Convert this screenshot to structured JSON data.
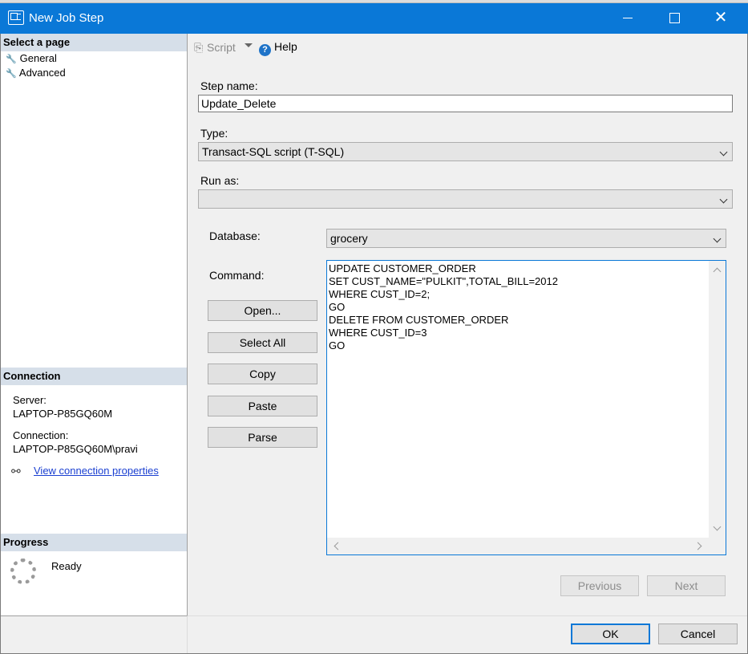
{
  "window": {
    "title": "New Job Step"
  },
  "left_panel": {
    "select_page_header": "Select a page",
    "pages": [
      {
        "label": "General"
      },
      {
        "label": "Advanced"
      }
    ],
    "connection_header": "Connection",
    "server_label": "Server:",
    "server_value": "LAPTOP-P85GQ60M",
    "connection_label": "Connection:",
    "connection_value": "LAPTOP-P85GQ60M\\pravi",
    "view_connection_link": "View connection properties",
    "progress_header": "Progress",
    "progress_status": "Ready"
  },
  "toolbar": {
    "script_label": "Script",
    "help_label": "Help"
  },
  "form": {
    "step_name_label": "Step name:",
    "step_name_value": "Update_Delete",
    "type_label": "Type:",
    "type_value": "Transact-SQL script (T-SQL)",
    "run_as_label": "Run as:",
    "run_as_value": "",
    "database_label": "Database:",
    "database_value": "grocery",
    "command_label": "Command:",
    "command_text": "UPDATE CUSTOMER_ORDER\nSET CUST_NAME=\"PULKIT\",TOTAL_BILL=2012\nWHERE CUST_ID=2;\nGO\nDELETE FROM CUSTOMER_ORDER\nWHERE CUST_ID=3\nGO"
  },
  "command_buttons": {
    "open": "Open...",
    "select_all": "Select All",
    "copy": "Copy",
    "paste": "Paste",
    "parse": "Parse"
  },
  "nav_buttons": {
    "previous": "Previous",
    "next": "Next"
  },
  "dialog_buttons": {
    "ok": "OK",
    "cancel": "Cancel"
  },
  "colors": {
    "titlebar": "#0a78d7",
    "section_header": "#d6dfe9",
    "link": "#1a3fd1"
  }
}
